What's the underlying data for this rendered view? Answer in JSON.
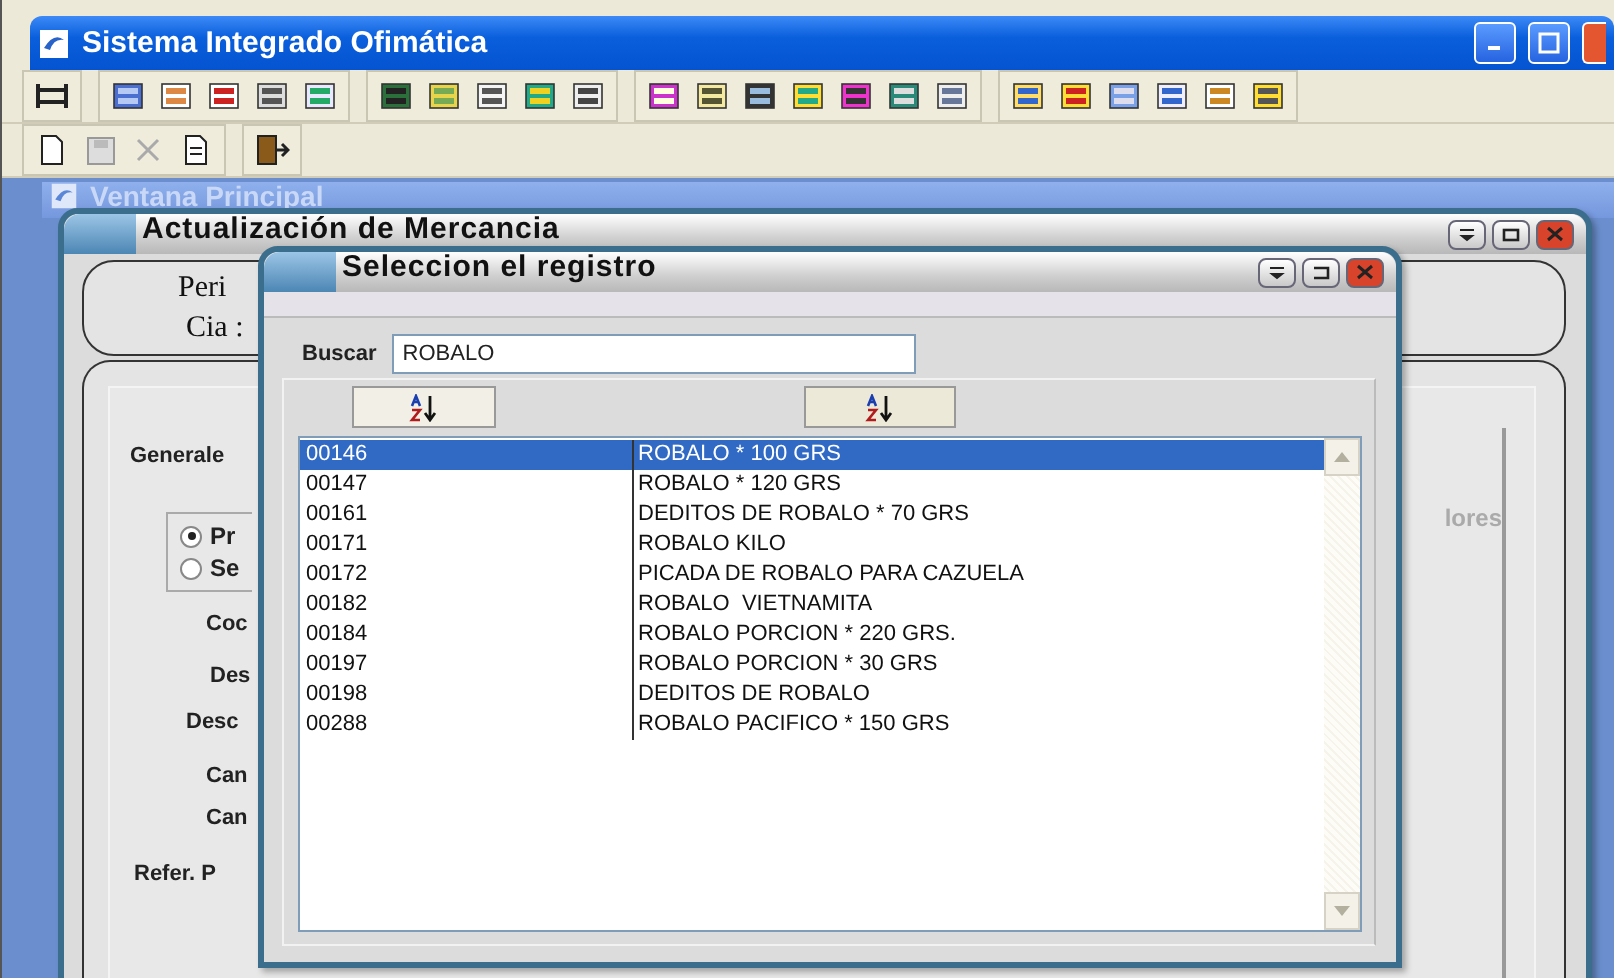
{
  "app": {
    "title": "Sistema Integrado Ofimática"
  },
  "mdi_window": {
    "title": "Ventana Principal"
  },
  "form": {
    "title": "Actualización de Mercancia",
    "header_labels": [
      "Peri",
      "Cia :"
    ],
    "section": "Generale",
    "radios": [
      {
        "label": "Pr",
        "selected": true
      },
      {
        "label": "Se",
        "selected": false
      }
    ],
    "field_labels": [
      "Coc",
      "Des",
      "Desc",
      "Can",
      "Can",
      "Refer. P"
    ],
    "group_label": "lores"
  },
  "dialog": {
    "title": "Seleccion el registro",
    "search": {
      "label": "Buscar",
      "value": "ROBALO"
    },
    "rows": [
      {
        "code": "00146",
        "description": "ROBALO * 100 GRS",
        "selected": true
      },
      {
        "code": "00147",
        "description": "ROBALO * 120 GRS",
        "selected": false
      },
      {
        "code": "00161",
        "description": "DEDITOS DE ROBALO * 70 GRS",
        "selected": false
      },
      {
        "code": "00171",
        "description": "ROBALO KILO",
        "selected": false
      },
      {
        "code": "00172",
        "description": "PICADA DE ROBALO PARA CAZUELA",
        "selected": false
      },
      {
        "code": "00182",
        "description": "ROBALO  VIETNAMITA",
        "selected": false
      },
      {
        "code": "00184",
        "description": "ROBALO PORCION * 220 GRS.",
        "selected": false
      },
      {
        "code": "00197",
        "description": "ROBALO PORCION * 30 GRS",
        "selected": false
      },
      {
        "code": "00198",
        "description": "DEDITOS DE ROBALO",
        "selected": false
      },
      {
        "code": "00288",
        "description": "ROBALO PACIFICO * 150 GRS",
        "selected": false
      }
    ]
  }
}
